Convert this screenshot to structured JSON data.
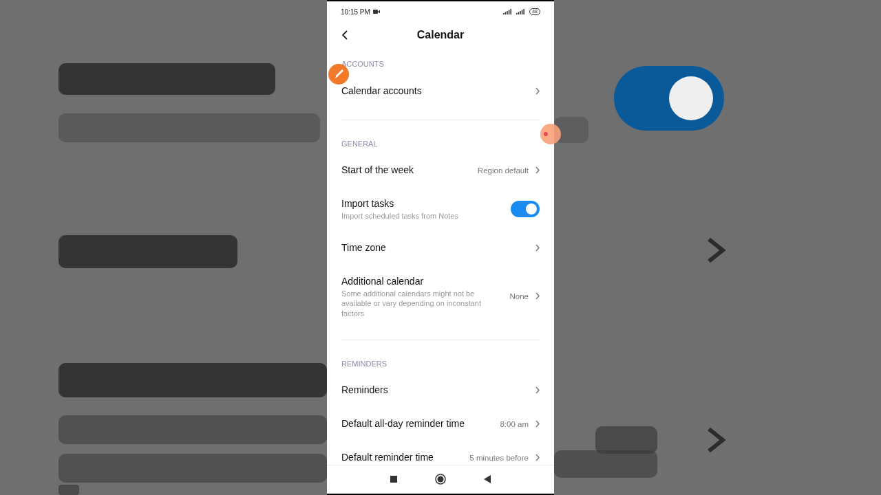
{
  "status_bar": {
    "time": "10:15 PM",
    "battery": "48"
  },
  "header": {
    "title": "Calendar"
  },
  "sections": [
    {
      "title": "ACCOUNTS",
      "items": [
        {
          "kind": "link",
          "label": "Calendar accounts"
        }
      ]
    },
    {
      "title": "GENERAL",
      "items": [
        {
          "kind": "link",
          "label": "Start of the week",
          "value": "Region default"
        },
        {
          "kind": "toggle",
          "label": "Import tasks",
          "description": "Import scheduled tasks from Notes",
          "on": true
        },
        {
          "kind": "link",
          "label": "Time zone"
        },
        {
          "kind": "link",
          "label": "Additional calendar",
          "description": "Some additional calendars might not be available or vary depending on inconstant factors",
          "value": "None"
        }
      ]
    },
    {
      "title": "REMINDERS",
      "items": [
        {
          "kind": "link",
          "label": "Reminders"
        },
        {
          "kind": "link",
          "label": "Default all-day reminder time",
          "value": "8:00 am"
        },
        {
          "kind": "link",
          "label": "Default reminder time",
          "value": "5 minutes before"
        }
      ]
    }
  ]
}
